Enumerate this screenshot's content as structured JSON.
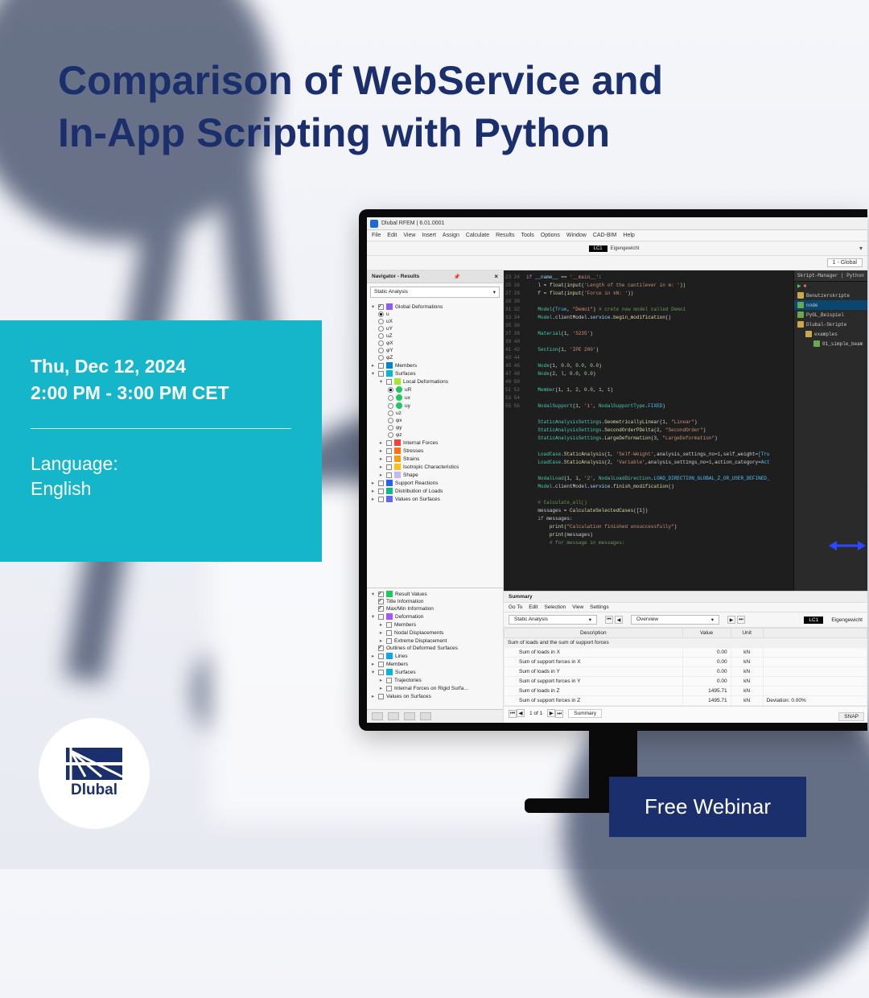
{
  "webinar": {
    "title_line1": "Comparison of WebService and",
    "title_line2": "In-App Scripting with Python",
    "date": "Thu, Dec 12, 2024",
    "time": "2:00 PM - 3:00 PM CET",
    "language_label": "Language:",
    "language_value": "English",
    "cta": "Free Webinar",
    "brand": "Dlubal"
  },
  "app": {
    "title": "Dlubal RFEM | 6.01.0001",
    "menus": [
      "File",
      "Edit",
      "View",
      "Insert",
      "Assign",
      "Calculate",
      "Results",
      "Tools",
      "Options",
      "Window",
      "CAD-BIM",
      "Help"
    ],
    "toolbar_icons": [
      "#3b82f6",
      "#f59e0b",
      "#10b981",
      "#d1d5db",
      "#d1d5db",
      "#d1d5db",
      "#d1d5db",
      "#d1d5db",
      "#d1d5db",
      "#d1d5db",
      "#a3e635",
      "#a3e635",
      "#93c5fd",
      "#93c5fd",
      "#c4b5fd",
      "#d1d5db",
      "#d1d5db",
      "#d1d5db",
      "#d1d5db",
      "#d1d5db"
    ],
    "toolbar2_icons": [
      "#d1d5db",
      "#d1d5db",
      "#d1d5db",
      "#d1d5db",
      "#d1d5db",
      "#d1d5db",
      "#d1d5db",
      "#d1d5db",
      "#d1d5db",
      "#facc15",
      "#facc15",
      "#d1d5db",
      "#60a5fa",
      "#60a5fa",
      "#d1d5db",
      "#34d399",
      "#34d399",
      "#f87171",
      "#fdba74"
    ],
    "lc_badge": "LC1",
    "lc_name": "Eigengewicht",
    "color_swatches": [
      "#ef4444",
      "#3b82f6",
      "#f59e0b",
      "#10b981"
    ],
    "global_dd": "1 - Global",
    "nav": {
      "title": "Navigator - Results",
      "dropdown": "Static Analysis",
      "tree": [
        {
          "lvl": 0,
          "exp": "▾",
          "cb": "on",
          "txt": "Global Deformations",
          "glyph": "#8b5cf6"
        },
        {
          "lvl": 1,
          "rb": "on",
          "txt": "u"
        },
        {
          "lvl": 1,
          "rb": "",
          "txt": "uX"
        },
        {
          "lvl": 1,
          "rb": "",
          "txt": "uY"
        },
        {
          "lvl": 1,
          "rb": "",
          "txt": "uZ"
        },
        {
          "lvl": 1,
          "rb": "",
          "txt": "φX"
        },
        {
          "lvl": 1,
          "rb": "",
          "txt": "φY"
        },
        {
          "lvl": 1,
          "rb": "",
          "txt": "φZ"
        },
        {
          "lvl": 0,
          "exp": "▸",
          "cb": "",
          "txt": "Members",
          "glyph": "#0284c7"
        },
        {
          "lvl": 0,
          "exp": "▾",
          "cb": "",
          "txt": "Surfaces",
          "glyph": "#06b6d4"
        },
        {
          "lvl": 1,
          "exp": "▾",
          "cb": "",
          "txt": "Local Deformations",
          "glyph": "#a3e635"
        },
        {
          "lvl": 2,
          "rb": "on",
          "txt": "uR",
          "dot": "#22c55e"
        },
        {
          "lvl": 2,
          "rb": "",
          "txt": "ux",
          "dot": "#22c55e"
        },
        {
          "lvl": 2,
          "rb": "",
          "txt": "uy",
          "dot": "#22c55e"
        },
        {
          "lvl": 2,
          "rb": "",
          "txt": "uz"
        },
        {
          "lvl": 2,
          "rb": "",
          "txt": "φx"
        },
        {
          "lvl": 2,
          "rb": "",
          "txt": "φy"
        },
        {
          "lvl": 2,
          "rb": "",
          "txt": "φz"
        },
        {
          "lvl": 1,
          "exp": "▸",
          "cb": "",
          "txt": "Internal Forces",
          "glyph": "#ef4444"
        },
        {
          "lvl": 1,
          "exp": "▸",
          "cb": "",
          "txt": "Stresses",
          "glyph": "#f97316"
        },
        {
          "lvl": 1,
          "exp": "▸",
          "cb": "",
          "txt": "Strains",
          "glyph": "#f59e0b"
        },
        {
          "lvl": 1,
          "exp": "▸",
          "cb": "",
          "txt": "Isotropic Characteristics",
          "glyph": "#fbbf24"
        },
        {
          "lvl": 1,
          "exp": "▸",
          "cb": "",
          "txt": "Shape",
          "glyph": "#c4b5fd"
        },
        {
          "lvl": 0,
          "exp": "▸",
          "cb": "",
          "txt": "Support Reactions",
          "glyph": "#2563eb"
        },
        {
          "lvl": 0,
          "exp": "▸",
          "cb": "",
          "txt": "Distribution of Loads",
          "glyph": "#10b981"
        },
        {
          "lvl": 0,
          "exp": "▸",
          "cb": "",
          "txt": "Values on Surfaces",
          "glyph": "#6366f1"
        }
      ],
      "tree2": [
        {
          "lvl": 0,
          "exp": "▾",
          "cb": "on",
          "txt": "Result Values",
          "glyph": "#22c55e"
        },
        {
          "lvl": 1,
          "cb": "on",
          "txt": "Title Information"
        },
        {
          "lvl": 1,
          "cb": "on",
          "txt": "Max/Min Information"
        },
        {
          "lvl": 0,
          "exp": "▾",
          "cb": "",
          "txt": "Deformation",
          "glyph": "#a855f7"
        },
        {
          "lvl": 1,
          "exp": "▸",
          "cb": "",
          "txt": "Members"
        },
        {
          "lvl": 1,
          "exp": "▸",
          "cb": "",
          "txt": "Nodal Displacements"
        },
        {
          "lvl": 1,
          "exp": "▸",
          "cb": "",
          "txt": "Extreme Displacement"
        },
        {
          "lvl": 1,
          "cb": "on",
          "txt": "Outlines of Deformed Surfaces"
        },
        {
          "lvl": 0,
          "exp": "▸",
          "cb": "",
          "txt": "Lines",
          "glyph": "#0ea5e9"
        },
        {
          "lvl": 0,
          "exp": "▸",
          "cb": "",
          "txt": "Members"
        },
        {
          "lvl": 0,
          "exp": "▾",
          "cb": "",
          "txt": "Surfaces",
          "glyph": "#06b6d4"
        },
        {
          "lvl": 1,
          "exp": "▸",
          "cb": "",
          "txt": "Trajectories"
        },
        {
          "lvl": 1,
          "exp": "▸",
          "cb": "",
          "txt": "Internal Forces on Rigid Surfa…"
        },
        {
          "lvl": 0,
          "exp": "▸",
          "cb": "",
          "txt": "Values on Surfaces"
        }
      ]
    },
    "code_start": 23,
    "code_lines": [
      [
        [
          "kw",
          "if"
        ],
        [
          "",
          " "
        ],
        [
          "attr",
          "__name__"
        ],
        [
          "",
          " == "
        ],
        [
          "str",
          "'__main__'"
        ],
        [
          "",
          ":"
        ]
      ],
      [
        [
          "",
          "    l = "
        ],
        [
          "fn",
          "float"
        ],
        [
          "",
          "("
        ],
        [
          "fn",
          "input"
        ],
        [
          "",
          "("
        ],
        [
          "str",
          "'Length of the cantilever in m: '"
        ],
        [
          "",
          ")) "
        ]
      ],
      [
        [
          "",
          "    f = "
        ],
        [
          "fn",
          "float"
        ],
        [
          "",
          "("
        ],
        [
          "fn",
          "input"
        ],
        [
          "",
          "("
        ],
        [
          "str",
          "'Force in kN: '"
        ],
        [
          "",
          ")) "
        ]
      ],
      [
        [
          "",
          ""
        ]
      ],
      [
        [
          "",
          "    "
        ],
        [
          "cls",
          "Model"
        ],
        [
          "",
          "("
        ],
        [
          "const",
          "True"
        ],
        [
          "",
          ", "
        ],
        [
          "str",
          "\"Demo1\""
        ],
        [
          "",
          ") "
        ],
        [
          "cmt",
          "# crete new model called Demo1"
        ]
      ],
      [
        [
          "",
          "    "
        ],
        [
          "cls",
          "Model"
        ],
        [
          "",
          ".clientModel."
        ],
        [
          "attr",
          "service"
        ],
        [
          "",
          "."
        ],
        [
          "fn",
          "begin_modification"
        ],
        [
          "",
          "()"
        ]
      ],
      [
        [
          "",
          ""
        ]
      ],
      [
        [
          "",
          "    "
        ],
        [
          "cls",
          "Material"
        ],
        [
          "",
          "(1, "
        ],
        [
          "str",
          "'S235'"
        ],
        [
          "",
          ")"
        ]
      ],
      [
        [
          "",
          ""
        ]
      ],
      [
        [
          "",
          "    "
        ],
        [
          "cls",
          "Section"
        ],
        [
          "",
          "(1, "
        ],
        [
          "str",
          "'IPE 200'"
        ],
        [
          "",
          ")"
        ]
      ],
      [
        [
          "",
          ""
        ]
      ],
      [
        [
          "",
          "    "
        ],
        [
          "cls",
          "Node"
        ],
        [
          "",
          "(1, "
        ],
        [
          "num",
          "0.0"
        ],
        [
          "",
          ", "
        ],
        [
          "num",
          "0.0"
        ],
        [
          "",
          ", "
        ],
        [
          "num",
          "0.0"
        ],
        [
          "",
          ")"
        ]
      ],
      [
        [
          "",
          "    "
        ],
        [
          "cls",
          "Node"
        ],
        [
          "",
          "(2, l, "
        ],
        [
          "num",
          "0.0"
        ],
        [
          "",
          ", "
        ],
        [
          "num",
          "0.0"
        ],
        [
          "",
          ")"
        ]
      ],
      [
        [
          "",
          ""
        ]
      ],
      [
        [
          "",
          "    "
        ],
        [
          "cls",
          "Member"
        ],
        [
          "",
          "(1, "
        ],
        [
          "num",
          "1"
        ],
        [
          "",
          ", "
        ],
        [
          "num",
          "2"
        ],
        [
          "",
          ", "
        ],
        [
          "num",
          "0.0"
        ],
        [
          "",
          ", "
        ],
        [
          "num",
          "1"
        ],
        [
          "",
          ", "
        ],
        [
          "num",
          "1"
        ],
        [
          "",
          ")"
        ]
      ],
      [
        [
          "",
          ""
        ]
      ],
      [
        [
          "",
          "    "
        ],
        [
          "cls",
          "NodalSupport"
        ],
        [
          "",
          "(1, "
        ],
        [
          "str",
          "'1'"
        ],
        [
          "",
          ", "
        ],
        [
          "cls",
          "NodalSupportType"
        ],
        [
          "",
          "."
        ],
        [
          "const",
          "FIXED"
        ],
        [
          "",
          ")"
        ]
      ],
      [
        [
          "",
          ""
        ]
      ],
      [
        [
          "",
          "    "
        ],
        [
          "cls",
          "StaticAnalysisSettings"
        ],
        [
          "",
          "."
        ],
        [
          "fn",
          "GeometricallyLinear"
        ],
        [
          "",
          "(1, "
        ],
        [
          "str",
          "\"Linear\""
        ],
        [
          "",
          ")"
        ]
      ],
      [
        [
          "",
          "    "
        ],
        [
          "cls",
          "StaticAnalysisSettings"
        ],
        [
          "",
          "."
        ],
        [
          "fn",
          "SecondOrderPDelta"
        ],
        [
          "",
          "(2, "
        ],
        [
          "str",
          "\"SecondOrder\""
        ],
        [
          "",
          ")"
        ]
      ],
      [
        [
          "",
          "    "
        ],
        [
          "cls",
          "StaticAnalysisSettings"
        ],
        [
          "",
          "."
        ],
        [
          "fn",
          "LargeDeformation"
        ],
        [
          "",
          "(3, "
        ],
        [
          "str",
          "\"LargeDeformation\""
        ],
        [
          "",
          ")"
        ]
      ],
      [
        [
          "",
          ""
        ]
      ],
      [
        [
          "",
          "    "
        ],
        [
          "cls",
          "LoadCase"
        ],
        [
          "",
          "."
        ],
        [
          "fn",
          "StaticAnalysis"
        ],
        [
          "",
          "(1, "
        ],
        [
          "str",
          "'Self-Weight'"
        ],
        [
          "",
          ",analysis_settings_no="
        ],
        [
          "num",
          "1"
        ],
        [
          "",
          ",self_weight="
        ],
        [
          "const",
          "[Tru"
        ]
      ],
      [
        [
          "",
          "    "
        ],
        [
          "cls",
          "LoadCase"
        ],
        [
          "",
          "."
        ],
        [
          "fn",
          "StaticAnalysis"
        ],
        [
          "",
          "(2, "
        ],
        [
          "str",
          "'Variable'"
        ],
        [
          "",
          ",analysis_settings_no="
        ],
        [
          "num",
          "1"
        ],
        [
          "",
          ",action_category="
        ],
        [
          "const",
          "Act"
        ]
      ],
      [
        [
          "",
          ""
        ]
      ],
      [
        [
          "",
          "    "
        ],
        [
          "cls",
          "NodalLoad"
        ],
        [
          "",
          "(1, 1, "
        ],
        [
          "str",
          "'2'"
        ],
        [
          "",
          ", "
        ],
        [
          "cls",
          "NodalLoadDirection"
        ],
        [
          "",
          "."
        ],
        [
          "const",
          "LOAD_DIRECTION_GLOBAL_Z_OR_USER_DEFINED_"
        ]
      ],
      [
        [
          "",
          "    "
        ],
        [
          "cls",
          "Model"
        ],
        [
          "",
          ".clientModel."
        ],
        [
          "attr",
          "service"
        ],
        [
          "",
          "."
        ],
        [
          "fn",
          "finish_modification"
        ],
        [
          "",
          "()"
        ]
      ],
      [
        [
          "",
          ""
        ]
      ],
      [
        [
          "",
          "    "
        ],
        [
          "cmt",
          "# Calculate_all()"
        ]
      ],
      [
        [
          "",
          "    messages = "
        ],
        [
          "fn",
          "CalculateSelectedCases"
        ],
        [
          "",
          "([1])"
        ]
      ],
      [
        [
          "",
          "    "
        ],
        [
          "kw",
          "if"
        ],
        [
          "",
          " messages:"
        ]
      ],
      [
        [
          "",
          "        "
        ],
        [
          "fn",
          "print"
        ],
        [
          "",
          "("
        ],
        [
          "str",
          "\"Calculation finished unsuccessfully\""
        ],
        [
          "",
          ")"
        ]
      ],
      [
        [
          "",
          "        "
        ],
        [
          "fn",
          "print"
        ],
        [
          "",
          "(messages)"
        ]
      ],
      [
        [
          "",
          "        "
        ],
        [
          "cmt",
          "# for message in messages:"
        ]
      ]
    ],
    "script_mgr": {
      "title": "Skript-Manager | Python",
      "items": [
        {
          "txt": "Benutzerskripte",
          "fold": true
        },
        {
          "txt": "node",
          "sel": true
        },
        {
          "txt": "PyGL_Beispiel"
        },
        {
          "txt": "Dlubal-Skripte",
          "fold": true
        },
        {
          "txt": "examples",
          "fold": true,
          "ind": 1
        },
        {
          "txt": "01_simple_beam",
          "ind": 2
        }
      ]
    },
    "summary": {
      "title": "Summary",
      "menu": [
        "Go To",
        "Edit",
        "Selection",
        "View",
        "Settings"
      ],
      "dd1": "Static Analysis",
      "dd2": "Overview",
      "lc_badge": "LC1",
      "lc_name": "Eigengewicht",
      "headers": [
        "Description",
        "Value",
        "Unit",
        ""
      ],
      "section": "Sum of loads and the sum of support forces",
      "rows": [
        [
          "Sum of loads in X",
          "0.00",
          "kN",
          ""
        ],
        [
          "Sum of support forces in X",
          "0.00",
          "kN",
          ""
        ],
        [
          "Sum of loads in Y",
          "0.00",
          "kN",
          ""
        ],
        [
          "Sum of support forces in Y",
          "0.00",
          "kN",
          ""
        ],
        [
          "Sum of loads in Z",
          "1495.71",
          "kN",
          ""
        ],
        [
          "Sum of support forces in Z",
          "1495.71",
          "kN",
          "Deviation: 0.00%"
        ]
      ],
      "foot_page": "1 of 1",
      "foot_tab": "Summary",
      "snap": "SNAP"
    }
  }
}
